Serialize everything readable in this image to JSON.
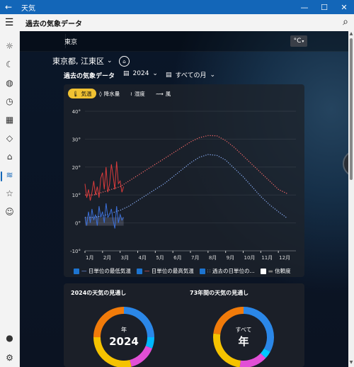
{
  "titlebar": {
    "back_icon": "back-arrow-icon",
    "title": "天気",
    "minimize": "—",
    "maximize": "☐",
    "close": "✕"
  },
  "appbar": {
    "title": "過去の気象データ"
  },
  "tabs": {
    "city": "東京",
    "unit": "°C"
  },
  "location": {
    "name": "東京都, 江東区"
  },
  "historical": {
    "section_title": "過去の気象データ",
    "year_select": "2024",
    "month_select": "すべての月",
    "chips": [
      "気温",
      "降水量",
      "湿度",
      "風"
    ],
    "legend": [
      "日単位の最低気温",
      "日単位の最高気温",
      "過去の日単位の...",
      "信頼度"
    ]
  },
  "outlook": {
    "card1_title": "2024の天気の見通し",
    "card1_top": "年",
    "card1_big": "2024",
    "card2_title": "73年間の天気の見通し",
    "card2_top": "すべて",
    "card2_big": "年"
  },
  "colors": {
    "accent": "#1366b8",
    "temp_chip": "#f1c232",
    "max_temp": "#d93b3b",
    "min_temp": "#3b6fd9"
  },
  "chart_data": {
    "type": "line",
    "x_ticks": [
      "1月",
      "2月",
      "3月",
      "4月",
      "5月",
      "6月",
      "7月",
      "8月",
      "9月",
      "10月",
      "11月",
      "12月"
    ],
    "y_ticks": [
      "40°",
      "30°",
      "20°",
      "10°",
      "0°",
      "-10°"
    ],
    "ylim": [
      -10,
      40
    ],
    "grid": true,
    "legend_position": "bottom",
    "series": [
      {
        "name": "過去の日単位の...",
        "kind": "dotted-max",
        "x": [
          1,
          1.5,
          2,
          2.5,
          3,
          3.5,
          4,
          4.5,
          5,
          5.5,
          6,
          6.5,
          7,
          7.5,
          8,
          8.5,
          9,
          9.5,
          10,
          10.5,
          11,
          11.5,
          12,
          12.5
        ],
        "y": [
          10,
          10,
          11,
          12,
          13,
          15,
          17,
          19,
          21,
          23,
          25,
          27,
          29,
          30.5,
          31.3,
          31.2,
          29.5,
          27,
          24,
          21,
          18,
          15,
          12,
          10.5
        ]
      },
      {
        "name": "過去の日単位の...",
        "kind": "dotted-min",
        "x": [
          1,
          1.5,
          2,
          2.5,
          3,
          3.5,
          4,
          4.5,
          5,
          5.5,
          6,
          6.5,
          7,
          7.5,
          8,
          8.5,
          9,
          9.5,
          10,
          10.5,
          11,
          11.5,
          12,
          12.5
        ],
        "y": [
          2,
          2,
          2.5,
          3.5,
          4.5,
          6,
          8,
          10,
          12,
          14,
          16.5,
          19,
          21.5,
          23.5,
          24.5,
          24.2,
          22.5,
          19.5,
          16.5,
          13,
          9.5,
          6.5,
          4,
          1.7
        ]
      },
      {
        "name": "日単位の最高気温",
        "kind": "solid-max",
        "x": [
          1,
          1.1,
          1.2,
          1.3,
          1.4,
          1.5,
          1.6,
          1.7,
          1.8,
          1.9,
          2,
          2.1,
          2.2,
          2.3,
          2.4,
          2.5,
          2.6,
          2.7,
          2.8,
          2.9,
          3,
          3.1,
          3.2
        ],
        "y": [
          14,
          9,
          12,
          8,
          11,
          15,
          10,
          13,
          9,
          16,
          18,
          12,
          20,
          11,
          14,
          21,
          17,
          12,
          22,
          14,
          15,
          11,
          13
        ]
      },
      {
        "name": "日単位の最低気温",
        "kind": "solid-min",
        "x": [
          1,
          1.1,
          1.2,
          1.3,
          1.4,
          1.5,
          1.6,
          1.7,
          1.8,
          1.9,
          2,
          2.1,
          2.2,
          2.3,
          2.4,
          2.5,
          2.6,
          2.7,
          2.8,
          2.9,
          3,
          3.1,
          3.2
        ],
        "y": [
          2,
          -1,
          4,
          0,
          5,
          1,
          3,
          -1,
          6,
          2,
          4,
          0,
          7,
          2,
          3,
          5,
          1,
          -2,
          6,
          0,
          3,
          1,
          2
        ]
      }
    ]
  },
  "donuts": [
    {
      "slices": [
        {
          "color": "#2b87e8",
          "value": 25
        },
        {
          "color": "#00b7ff",
          "value": 6
        },
        {
          "color": "#e24fd6",
          "value": 15
        },
        {
          "color": "#f5c300",
          "value": 29
        },
        {
          "color": "#f17b0a",
          "value": 25
        }
      ]
    },
    {
      "slices": [
        {
          "color": "#2b87e8",
          "value": 33
        },
        {
          "color": "#00c6ff",
          "value": 4
        },
        {
          "color": "#e24fd6",
          "value": 15
        },
        {
          "color": "#f5c300",
          "value": 25
        },
        {
          "color": "#f17b0a",
          "value": 23
        }
      ]
    }
  ]
}
